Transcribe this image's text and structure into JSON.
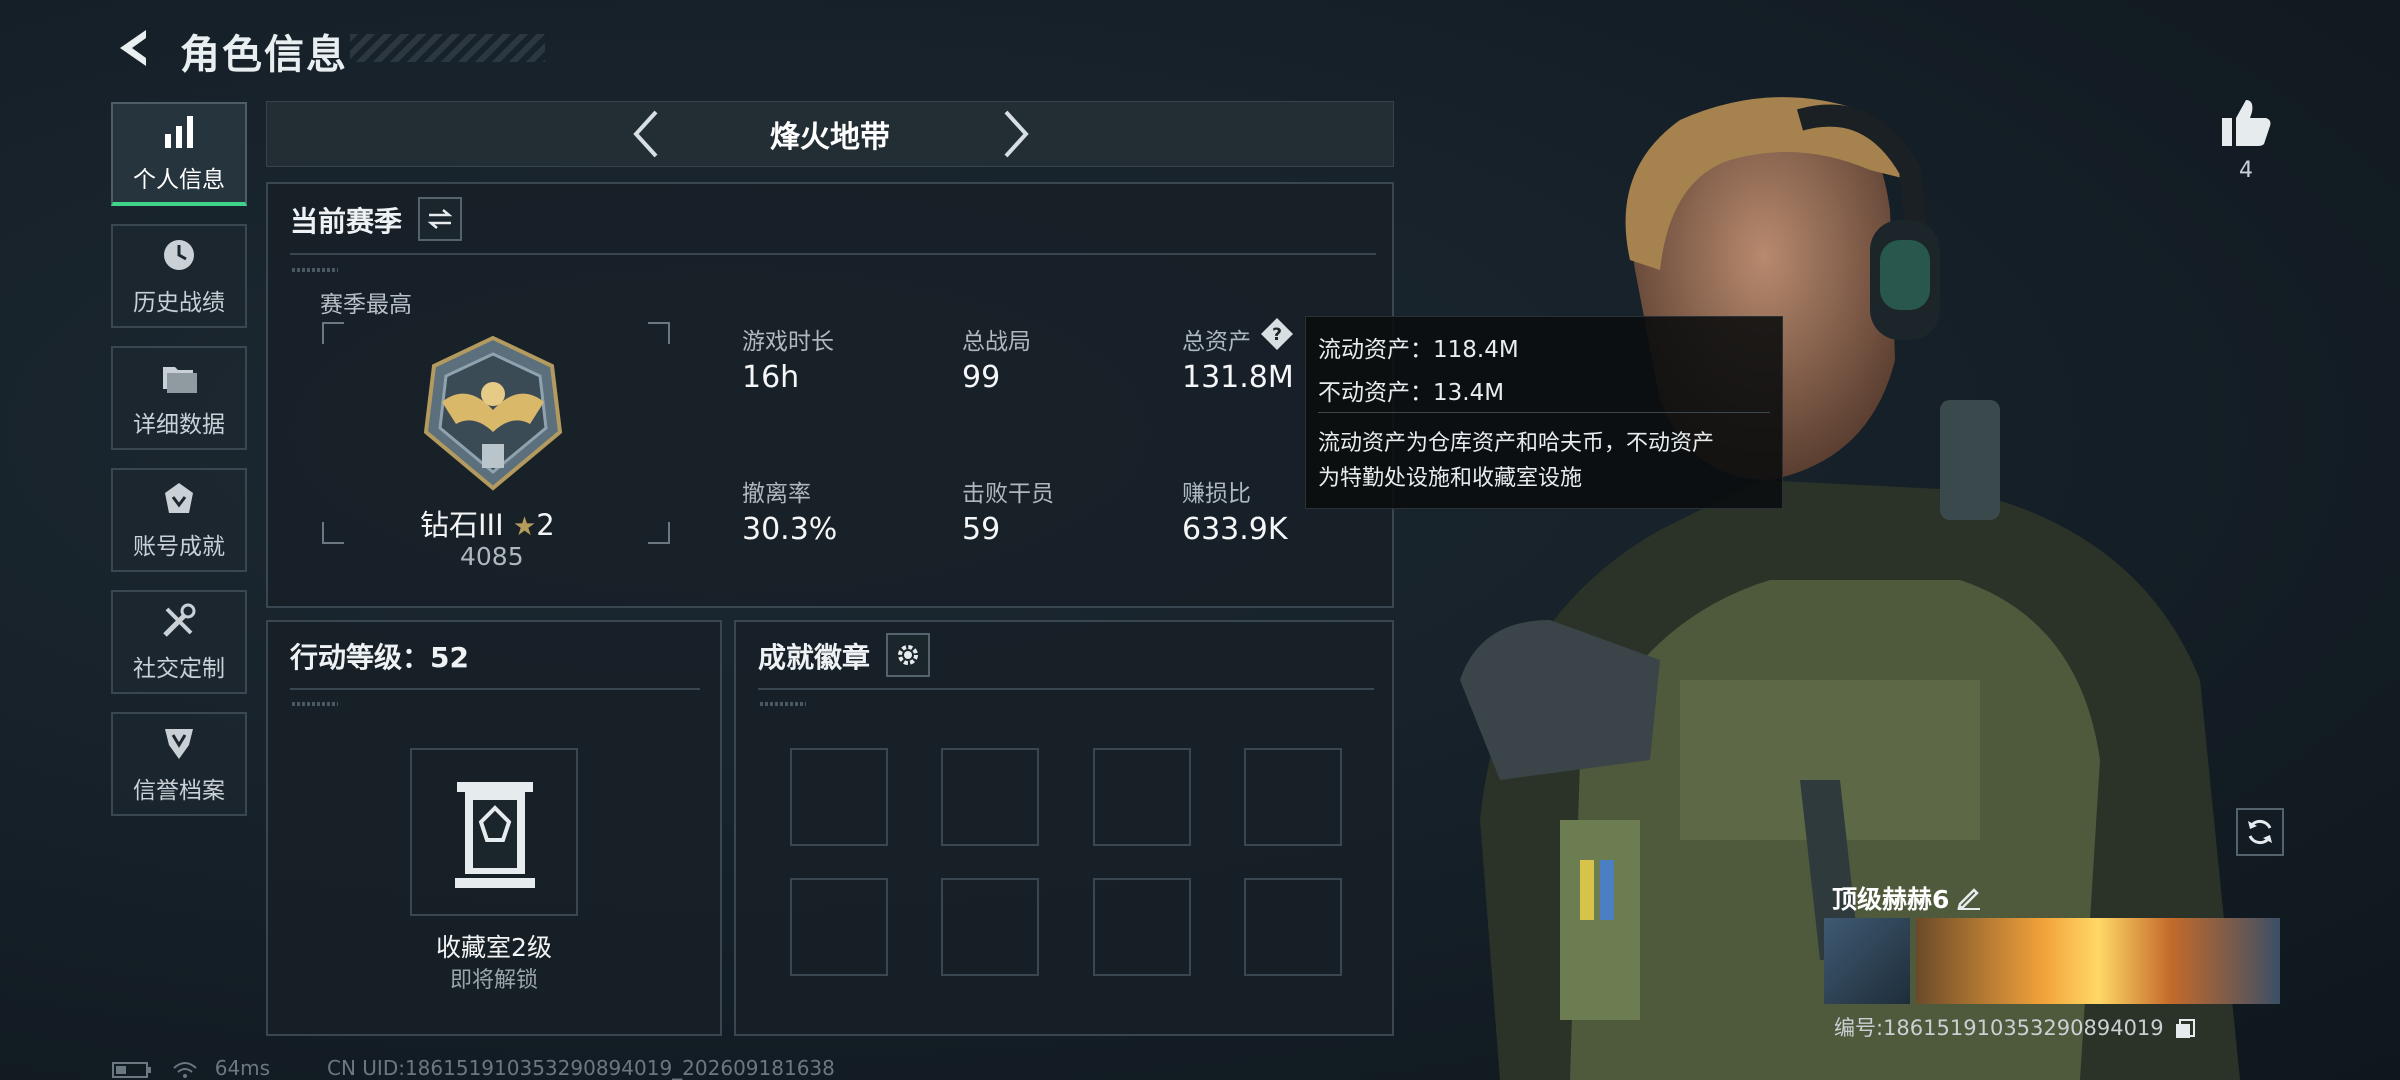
{
  "header": {
    "title": "角色信息"
  },
  "sidebar": {
    "items": [
      {
        "label": "个人信息",
        "icon": "bar-chart-icon",
        "active": true
      },
      {
        "label": "历史战绩",
        "icon": "history-clock-icon"
      },
      {
        "label": "详细数据",
        "icon": "folder-stack-icon"
      },
      {
        "label": "账号成就",
        "icon": "achievement-icon"
      },
      {
        "label": "社交定制",
        "icon": "tools-icon"
      },
      {
        "label": "信誉档案",
        "icon": "reputation-badge-icon"
      }
    ]
  },
  "mode": {
    "title": "烽火地带"
  },
  "season": {
    "title": "当前赛季",
    "best_label": "赛季最高",
    "rank_name": "钻石III",
    "rank_stars": "2",
    "rank_score": "4085",
    "stats": [
      {
        "label": "游戏时长",
        "value": "16h"
      },
      {
        "label": "总战局",
        "value": "99"
      },
      {
        "label": "总资产",
        "value": "131.8M"
      },
      {
        "label": "撤离率",
        "value": "30.3%"
      },
      {
        "label": "击败干员",
        "value": "59"
      },
      {
        "label": "赚损比",
        "value": "633.9K"
      }
    ]
  },
  "tooltip": {
    "line1": "流动资产：118.4M",
    "line2": "不动资产：13.4M",
    "desc1": "流动资产为仓库资产和哈夫币，不动资产",
    "desc2": "为特勤处设施和收藏室设施"
  },
  "action_level": {
    "title": "行动等级：52",
    "item_name": "收藏室2级",
    "item_status": "即将解锁"
  },
  "badges": {
    "title": "成就徽章"
  },
  "profile": {
    "likes": "4",
    "nickname": "顶级赫赫6",
    "id_text": "编号:1861519103532908940​19"
  },
  "status_bar": {
    "ping": "64ms",
    "cn_uid": "CN UID:186151910353290894019_202609181638"
  },
  "colors": {
    "accent": "#3fd48a",
    "panel_border": "#3a4650",
    "background": "#151f27"
  }
}
